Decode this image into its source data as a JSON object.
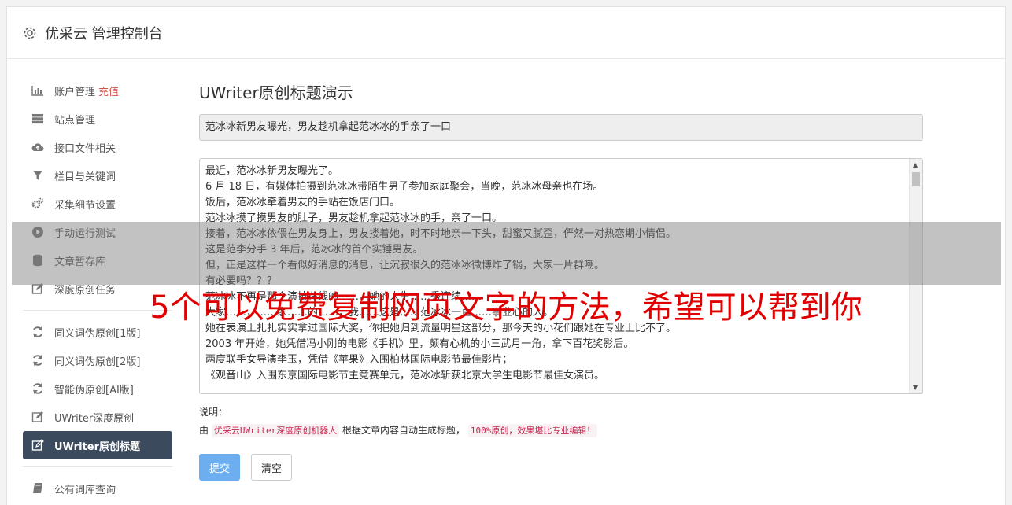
{
  "header": {
    "title": "优采云 管理控制台",
    "icon": "gear-icon"
  },
  "sidebar": {
    "group1": [
      {
        "label": "账户管理",
        "extra": "充值",
        "icon": "bar-chart-icon"
      },
      {
        "label": "站点管理",
        "icon": "server-icon"
      },
      {
        "label": "接口文件相关",
        "icon": "cloud-upload-icon"
      },
      {
        "label": "栏目与关键词",
        "icon": "filter-icon"
      },
      {
        "label": "采集细节设置",
        "icon": "gears-icon"
      },
      {
        "label": "手动运行测试",
        "icon": "play-circle-icon"
      },
      {
        "label": "文章暂存库",
        "icon": "database-icon"
      },
      {
        "label": "深度原创任务",
        "icon": "edit-icon"
      }
    ],
    "group2": [
      {
        "label": "同义词伪原创[1版]",
        "icon": "refresh-icon"
      },
      {
        "label": "同义词伪原创[2版]",
        "icon": "refresh-icon"
      },
      {
        "label": "智能伪原创[AI版]",
        "icon": "refresh-icon"
      },
      {
        "label": "UWriter深度原创",
        "icon": "edit-icon"
      },
      {
        "label": "UWriter原创标题",
        "icon": "edit-icon",
        "active": true
      }
    ],
    "group3": [
      {
        "label": "公有词库查询",
        "icon": "book-icon"
      }
    ]
  },
  "main": {
    "page_title": "UWriter原创标题演示",
    "title_value": "范冰冰新男友曝光，男友趁机拿起范冰冰的手亲了一口",
    "content_lines": [
      "最近，范冰冰新男友曝光了。",
      "6 月 18 日，有媒体拍摄到范冰冰带陌生男子参加家庭聚会，当晚，范冰冰母亲也在场。",
      "饭后，范冰冰牵着男友的手站在饭店门口。",
      "范冰冰摸了摸男友的肚子，男友趁机拿起范冰冰的手，亲了一口。",
      "接着，范冰冰依偎在男友身上，男友搂着她，时不时地亲一下头，甜蜜又腻歪，俨然一对热恋期小情侣。",
      "这是范李分手 3 年后，范冰冰的首个实锤男友。",
      "但，正是这样一个看似好消息的消息，让沉寂很久的范冰冰微博炸了锅，大家一片群嘲。",
      "有必要吗？？？",
      "范冰冰不再是那个演技在线的……，她的人生……秀连续……",
      "大家……，……家……的……，我……这是……范冰冰一直……事业心的人。",
      "她在表演上扎扎实实拿过国际大奖，你把她归到流量明星这部分，那今天的小花们跟她在专业上比不了。",
      "2003 年开始，她凭借冯小刚的电影《手机》里，颇有心机的小三武月一角，拿下百花奖影后。",
      "两度联手女导演李玉，凭借《苹果》入围柏林国际电影节最佳影片；",
      "《观音山》入围东京国际电影节主竞赛单元，范冰冰斩获北京大学生电影节最佳女演员。"
    ],
    "note_label": "说明：",
    "note_prefix": "由",
    "note_code1": "优采云UWriter深度原创机器人",
    "note_middle": "根据文章内容自动生成标题，",
    "note_code2": "100%原创，效果堪比专业编辑！",
    "submit_label": "提交",
    "clear_label": "清空"
  },
  "overlay": {
    "caption": "5个可以免费复制网页文字的方法，希望可以帮到你"
  },
  "colors": {
    "active_nav": "#3c4a5e",
    "primary": "#6caef0",
    "recharge": "#d9534f",
    "overlay_text": "#e00000"
  }
}
